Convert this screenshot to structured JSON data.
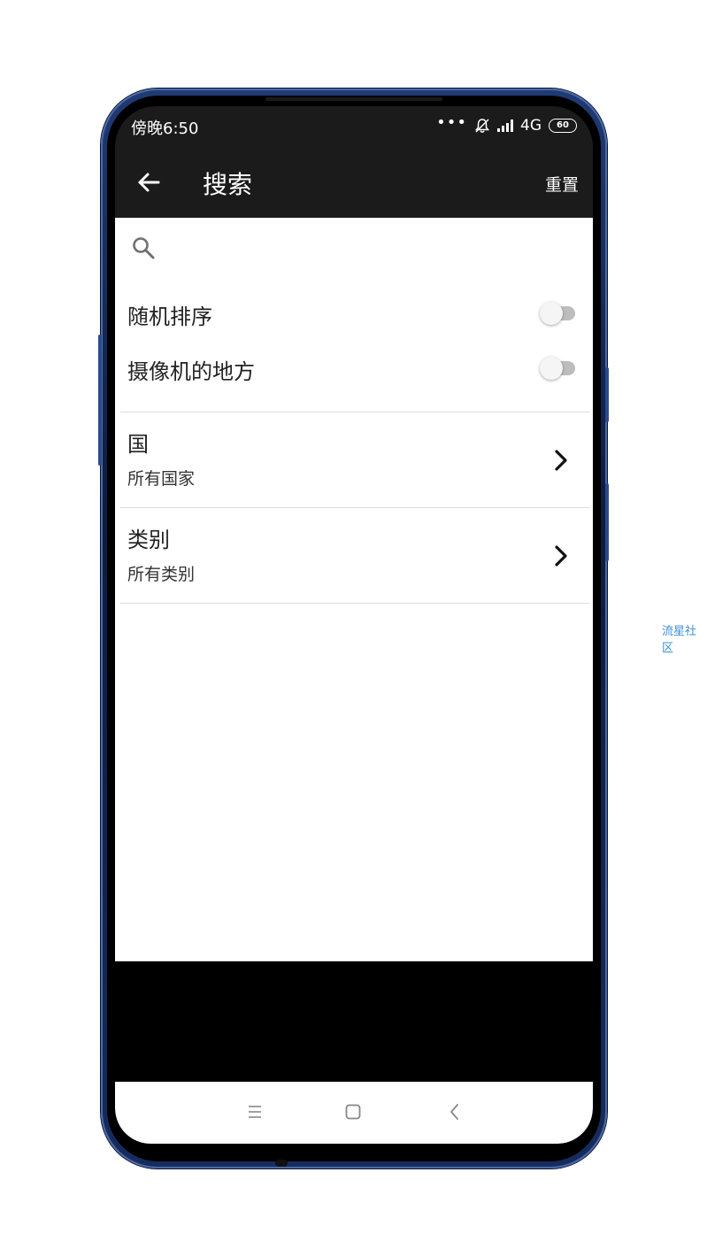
{
  "status_bar": {
    "time": "傍晚6:50",
    "dots": "•••",
    "network": "4G",
    "battery": "60"
  },
  "app_bar": {
    "title": "搜索",
    "reset_label": "重置"
  },
  "search": {
    "icon": "search-icon"
  },
  "toggles": [
    {
      "label": "随机排序",
      "on": false
    },
    {
      "label": "摄像机的地方",
      "on": false
    }
  ],
  "nav_items": [
    {
      "title": "国",
      "subtitle": "所有国家"
    },
    {
      "title": "类别",
      "subtitle": "所有类别"
    }
  ],
  "system_nav": {
    "icons": [
      "menu-icon",
      "home-icon",
      "back-icon"
    ]
  },
  "watermark": "流星社区",
  "colors": {
    "app_bar": "#1b1b1b",
    "frame": "#1a3370",
    "watermark": "#3a8fd8"
  }
}
